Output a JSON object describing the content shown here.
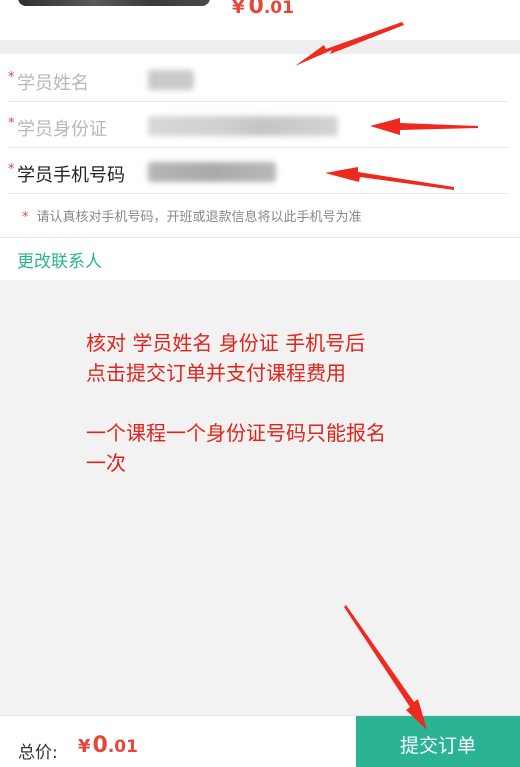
{
  "product": {
    "price_symbol": "¥",
    "price_int": "0",
    "price_dec": ".01"
  },
  "form": {
    "required_mark": "*",
    "name_label": "学员姓名",
    "id_label": "学员身份证",
    "phone_label": "学员手机号码",
    "notice_star": "*",
    "notice": "请认真核对手机号码，开班或退款信息将以此手机号为准",
    "change_contact": "更改联系人"
  },
  "annotation": {
    "line1": "核对 学员姓名  身份证 手机号后",
    "line2": "点击提交订单并支付课程费用",
    "line3": "一个课程一个身份证号码只能报名",
    "line4": "一次"
  },
  "footer": {
    "total_label": "总价:",
    "price_symbol": "¥",
    "price_int": "0",
    "price_dec": ".01",
    "submit": "提交订单"
  },
  "colors": {
    "accent_green": "#2bb394",
    "price_red": "#e8463a",
    "annotation_red": "#e3231b"
  }
}
